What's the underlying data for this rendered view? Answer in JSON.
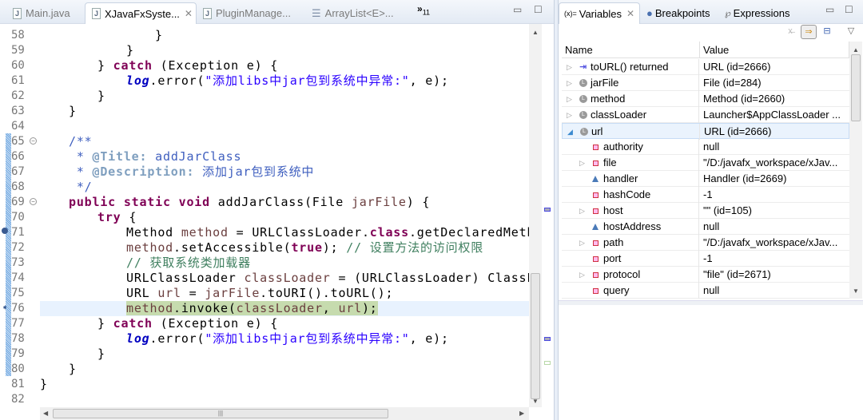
{
  "editor": {
    "tabs": [
      {
        "label": "Main.java",
        "active": false,
        "icon": "java-file-icon"
      },
      {
        "label": "XJavaFxSyste...",
        "active": true,
        "icon": "java-file-icon"
      },
      {
        "label": "PluginManage...",
        "active": false,
        "icon": "java-file-icon"
      },
      {
        "label": "ArrayList<E>...",
        "active": false,
        "icon": "class-file-icon"
      }
    ],
    "overflow_label": "»",
    "overflow_count": "11",
    "current_line": "76",
    "lines": [
      {
        "n": "58",
        "tokens": [
          [
            "\t\t\t\t}",
            ""
          ]
        ]
      },
      {
        "n": "59",
        "tokens": [
          [
            "\t\t\t}",
            ""
          ]
        ]
      },
      {
        "n": "60",
        "tokens": [
          [
            "\t\t} ",
            ""
          ],
          [
            "catch",
            "kw"
          ],
          [
            " (Exception e) {",
            ""
          ]
        ]
      },
      {
        "n": "61",
        "tokens": [
          [
            "\t\t\t",
            ""
          ],
          [
            "log",
            "fld"
          ],
          [
            ".error(",
            ""
          ],
          [
            "\"添加libs中jar包到系统中异常:\"",
            "str"
          ],
          [
            ", e);",
            ""
          ]
        ]
      },
      {
        "n": "62",
        "tokens": [
          [
            "\t\t}",
            ""
          ]
        ]
      },
      {
        "n": "63",
        "tokens": [
          [
            "\t}",
            ""
          ]
        ]
      },
      {
        "n": "64",
        "tokens": []
      },
      {
        "n": "65",
        "fold": true,
        "tokens": [
          [
            "\t",
            ""
          ],
          [
            "/**",
            "doc"
          ]
        ]
      },
      {
        "n": "66",
        "tokens": [
          [
            "\t",
            ""
          ],
          [
            " * ",
            "doc"
          ],
          [
            "@Title:",
            "tag"
          ],
          [
            " addJarClass",
            "doc"
          ]
        ]
      },
      {
        "n": "67",
        "tokens": [
          [
            "\t",
            ""
          ],
          [
            " * ",
            "doc"
          ],
          [
            "@Description:",
            "tag"
          ],
          [
            " 添加jar包到系统中",
            "doc"
          ]
        ]
      },
      {
        "n": "68",
        "tokens": [
          [
            "\t",
            ""
          ],
          [
            " */",
            "doc"
          ]
        ]
      },
      {
        "n": "69",
        "fold": true,
        "tokens": [
          [
            "\t",
            ""
          ],
          [
            "public static void",
            "kw"
          ],
          [
            " addJarClass(File ",
            ""
          ],
          [
            "jarFile",
            "var"
          ],
          [
            ") {",
            ""
          ]
        ]
      },
      {
        "n": "70",
        "tokens": [
          [
            "\t\t",
            ""
          ],
          [
            "try",
            "kw"
          ],
          [
            " {",
            ""
          ]
        ]
      },
      {
        "n": "71",
        "tokens": [
          [
            "\t\t\tMethod ",
            ""
          ],
          [
            "method",
            "var"
          ],
          [
            " = URLClassLoader.",
            ""
          ],
          [
            "class",
            "kw"
          ],
          [
            ".getDeclaredMethod(\"",
            ""
          ]
        ]
      },
      {
        "n": "72",
        "tokens": [
          [
            "\t\t\t",
            ""
          ],
          [
            "method",
            "var"
          ],
          [
            ".setAccessible(",
            ""
          ],
          [
            "true",
            "kw"
          ],
          [
            "); ",
            ""
          ],
          [
            "// 设置方法的访问权限",
            "cm"
          ]
        ]
      },
      {
        "n": "73",
        "tokens": [
          [
            "\t\t\t",
            ""
          ],
          [
            "// 获取系统类加载器",
            "cm"
          ]
        ]
      },
      {
        "n": "74",
        "tokens": [
          [
            "\t\t\tURLClassLoader ",
            ""
          ],
          [
            "classLoader",
            "var"
          ],
          [
            " = (URLClassLoader) ClassLoade",
            ""
          ]
        ]
      },
      {
        "n": "75",
        "tokens": [
          [
            "\t\t\tURL ",
            ""
          ],
          [
            "url",
            "var"
          ],
          [
            " = ",
            ""
          ],
          [
            "jarFile",
            "var"
          ],
          [
            ".toURI().toURL();",
            ""
          ]
        ]
      },
      {
        "n": "76",
        "tokens": [
          [
            "\t\t\t",
            ""
          ],
          [
            "method",
            "var hl"
          ],
          [
            ".invoke(",
            "hl"
          ],
          [
            "classLoader",
            "var hl"
          ],
          [
            ", ",
            "hl"
          ],
          [
            "url",
            "var hl"
          ],
          [
            ");",
            "hl"
          ]
        ]
      },
      {
        "n": "77",
        "tokens": [
          [
            "\t\t} ",
            ""
          ],
          [
            "catch",
            "kw"
          ],
          [
            " (Exception e) {",
            ""
          ]
        ]
      },
      {
        "n": "78",
        "tokens": [
          [
            "\t\t\t",
            ""
          ],
          [
            "log",
            "fld"
          ],
          [
            ".error(",
            ""
          ],
          [
            "\"添加libs中jar包到系统中异常:\"",
            "str"
          ],
          [
            ", e);",
            ""
          ]
        ]
      },
      {
        "n": "79",
        "tokens": [
          [
            "\t\t}",
            ""
          ]
        ]
      },
      {
        "n": "80",
        "tokens": [
          [
            "\t}",
            ""
          ]
        ]
      },
      {
        "n": "81",
        "tokens": [
          [
            "}",
            ""
          ]
        ]
      },
      {
        "n": "82",
        "tokens": []
      }
    ]
  },
  "variables": {
    "tabs": [
      {
        "label": "Variables",
        "icon": "variables-icon",
        "icon_text": "(x)=",
        "active": true
      },
      {
        "label": "Breakpoints",
        "icon": "breakpoints-icon",
        "active": false
      },
      {
        "label": "Expressions",
        "icon": "expressions-icon",
        "active": false
      }
    ],
    "columns": {
      "name": "Name",
      "value": "Value"
    },
    "rows": [
      {
        "name": "toURL() returned",
        "value": "URL  (id=2666)",
        "exp": "collapsed",
        "icon": "return",
        "level": 0
      },
      {
        "name": "jarFile",
        "value": "File  (id=284)",
        "exp": "collapsed",
        "icon": "local",
        "level": 0
      },
      {
        "name": "method",
        "value": "Method  (id=2660)",
        "exp": "collapsed",
        "icon": "local",
        "level": 0
      },
      {
        "name": "classLoader",
        "value": "Launcher$AppClassLoader ...",
        "exp": "collapsed",
        "icon": "local",
        "level": 0
      },
      {
        "name": "url",
        "value": "URL  (id=2666)",
        "exp": "expanded",
        "icon": "local",
        "level": 0,
        "selected": true
      },
      {
        "name": "authority",
        "value": "null",
        "exp": "none",
        "icon": "private",
        "level": 1
      },
      {
        "name": "file",
        "value": "\"/D:/javafx_workspace/xJav...",
        "exp": "collapsed",
        "icon": "private",
        "level": 1
      },
      {
        "name": "handler",
        "value": "Handler  (id=2669)",
        "exp": "none",
        "icon": "default",
        "level": 1
      },
      {
        "name": "hashCode",
        "value": "-1",
        "exp": "none",
        "icon": "private",
        "level": 1
      },
      {
        "name": "host",
        "value": "\"\" (id=105)",
        "exp": "collapsed",
        "icon": "private",
        "level": 1
      },
      {
        "name": "hostAddress",
        "value": "null",
        "exp": "none",
        "icon": "default",
        "level": 1
      },
      {
        "name": "path",
        "value": "\"/D:/javafx_workspace/xJav...",
        "exp": "collapsed",
        "icon": "private",
        "level": 1
      },
      {
        "name": "port",
        "value": "-1",
        "exp": "none",
        "icon": "private",
        "level": 1
      },
      {
        "name": "protocol",
        "value": "\"file\" (id=2671)",
        "exp": "collapsed",
        "icon": "private",
        "level": 1
      },
      {
        "name": "query",
        "value": "null",
        "exp": "none",
        "icon": "private",
        "level": 1
      }
    ]
  }
}
